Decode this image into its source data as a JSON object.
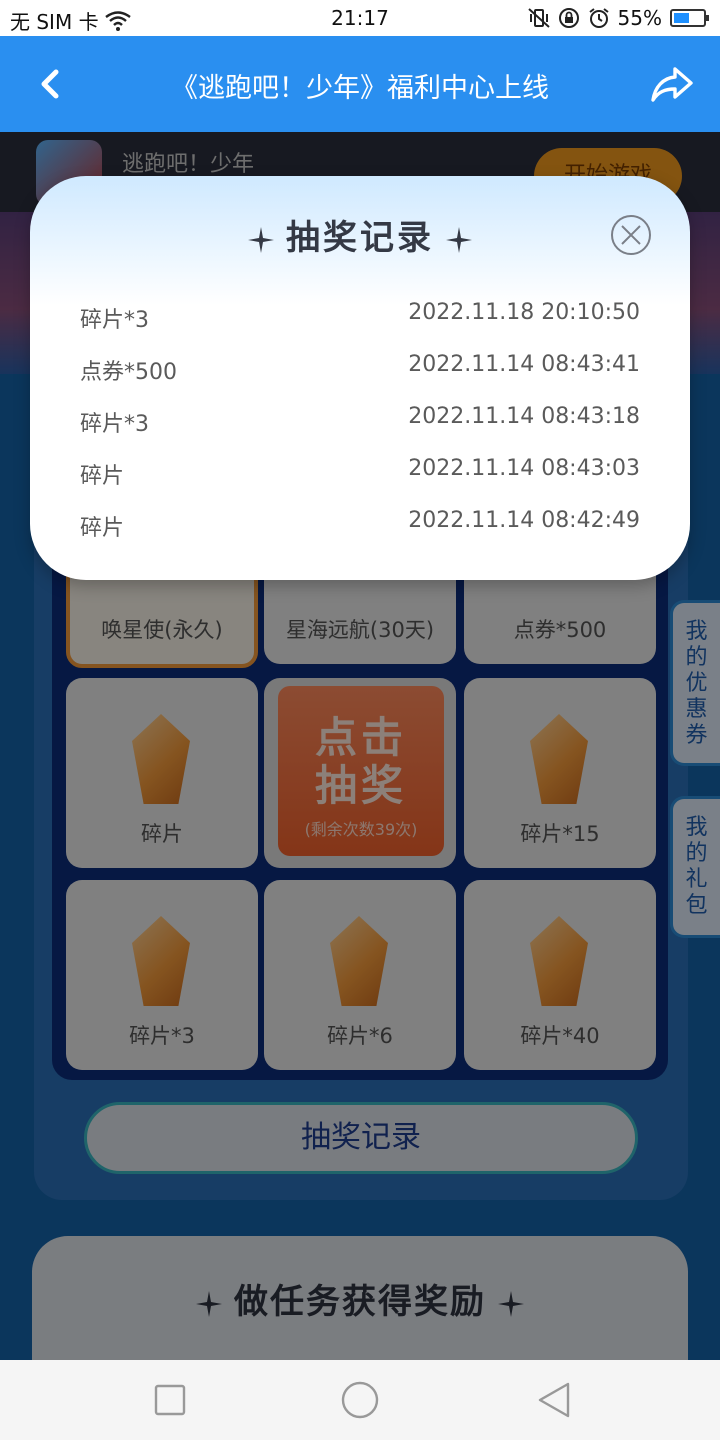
{
  "status_bar": {
    "carrier": "无 SIM 卡",
    "time": "21:17",
    "battery_percent": "55%",
    "battery_level": 0.55,
    "icons": [
      "wifi-icon",
      "vibrate-icon",
      "rotation-lock-icon",
      "alarm-icon",
      "battery-icon"
    ]
  },
  "header": {
    "title": "《逃跑吧！少年》福利中心上线",
    "back_icon": "chevron-left-icon",
    "share_icon": "share-icon"
  },
  "game": {
    "name": "逃跑吧！少年",
    "start_label": "开始游戏"
  },
  "prize_grid": {
    "cells": [
      {
        "label": "唤星使(永久)"
      },
      {
        "label": "星海远航(30天)"
      },
      {
        "label": "点券*500"
      },
      {
        "label": "碎片"
      },
      {
        "label": "碎片*15"
      },
      {
        "label": "碎片*3"
      },
      {
        "label": "碎片*6"
      },
      {
        "label": "碎片*40"
      }
    ],
    "draw_button": {
      "title": "点击抽奖",
      "remaining": "(剩余次数39次)"
    }
  },
  "record_button_label": "抽奖记录",
  "task_title": "做任务获得奖励",
  "side_tabs": {
    "coupons": "我的优惠券",
    "gifts": "我的礼包"
  },
  "modal": {
    "title": "抽奖记录",
    "close_icon": "close-circle-icon",
    "records": [
      {
        "name": "碎片*3",
        "time": "2022.11.18 20:10:50"
      },
      {
        "name": "点券*500",
        "time": "2022.11.14 08:43:41"
      },
      {
        "name": "碎片*3",
        "time": "2022.11.14 08:43:18"
      },
      {
        "name": "碎片",
        "time": "2022.11.14 08:43:03"
      },
      {
        "name": "碎片",
        "time": "2022.11.14 08:42:49"
      }
    ]
  },
  "nav": {
    "icons": [
      "recent-apps-icon",
      "home-icon",
      "back-icon"
    ]
  },
  "colors": {
    "title_bar": "#2a8ff0",
    "accent_orange": "#f1612c",
    "page_blue": "#1563a8"
  }
}
